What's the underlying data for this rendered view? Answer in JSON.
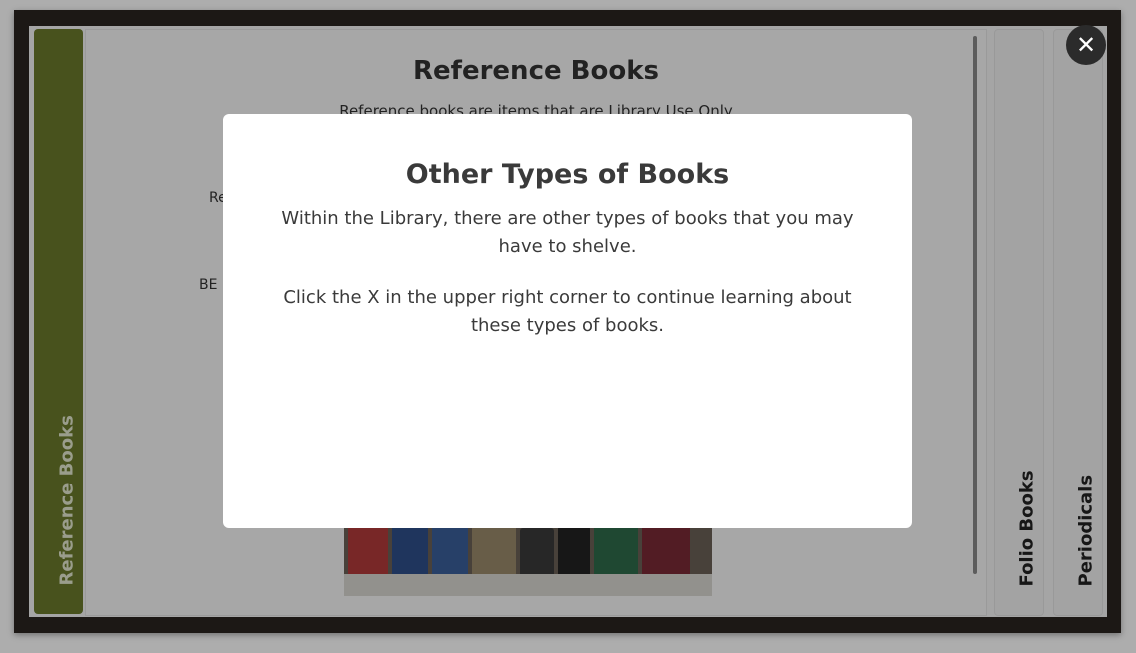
{
  "tabs": {
    "reference": "Reference Books",
    "folio": "Folio Books",
    "periodicals": "Periodicals"
  },
  "background": {
    "title": "Reference Books",
    "subtitle": "Reference books are items that are Library Use Only",
    "fragment1": "Re",
    "fragment2": "BE"
  },
  "modal": {
    "title": "Other Types of Books",
    "paragraph1": "Within the Library, there are other types of books that you may have to shelve.",
    "paragraph2": "Click the X in the upper right corner to continue learning about these types of books."
  },
  "close_icon": "close-icon",
  "colors": {
    "accent_tab": "#6a7a2c",
    "frame": "#2a2420",
    "close_button": "#2b2b2b"
  }
}
